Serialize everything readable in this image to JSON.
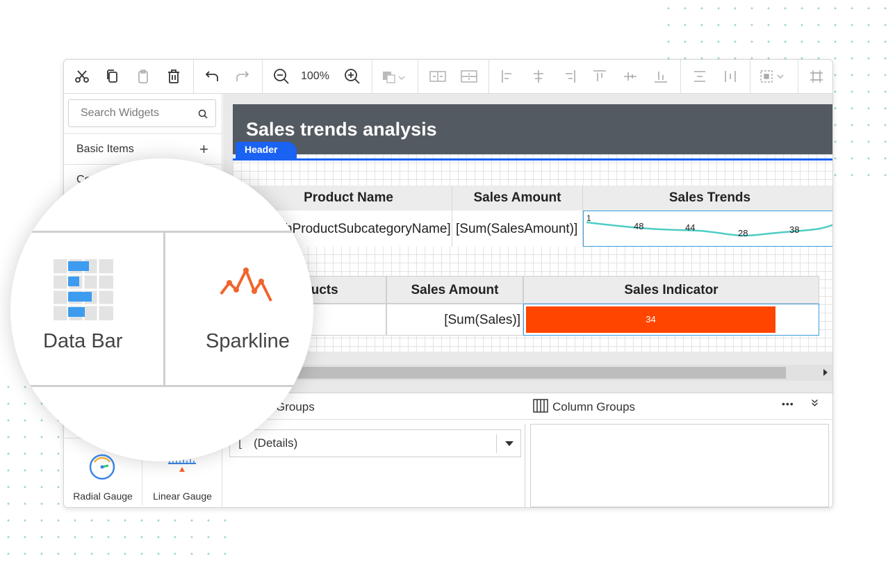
{
  "toolbar": {
    "zoom_level": "100%",
    "icons": [
      "cut-icon",
      "copy-icon",
      "paste-icon",
      "delete-icon",
      "undo-icon",
      "redo-icon",
      "zoom-out-icon",
      "zoom-in-icon",
      "fill-color-icon",
      "align-icons",
      "layout-icons"
    ]
  },
  "sidebar": {
    "search_placeholder": "Search Widgets",
    "categories": [
      {
        "label": "Basic Items",
        "expand": "+"
      },
      {
        "label": "Co"
      }
    ],
    "widgets": [
      {
        "label": "Radial Gauge",
        "icon": "radial-gauge-icon"
      },
      {
        "label": "Linear Gauge",
        "icon": "linear-gauge-icon"
      }
    ]
  },
  "magnifier": {
    "widgets": [
      {
        "label": "Data Bar",
        "icon": "data-bar-icon"
      },
      {
        "label": "Sparkline",
        "icon": "sparkline-icon"
      }
    ],
    "accent_color": "#4aa3f0",
    "sparkline_color": "#f0652d"
  },
  "report": {
    "title": "Sales trends analysis",
    "header_tag": "Header",
    "table1": {
      "headers": [
        "Product Name",
        "Sales Amount",
        "Sales Trends"
      ],
      "row": [
        "[EnglishProductSubcategoryName]",
        "[Sum(SalesAmount)]"
      ]
    },
    "sparkline": {
      "labels": [
        "1",
        "48",
        "44",
        "28",
        "38"
      ],
      "line_color": "#4ecdc4"
    },
    "table2": {
      "headers": [
        "Products",
        "Sales Amount",
        "Sales Indicator"
      ],
      "row": [
        "",
        "[Sum(Sales)]"
      ],
      "databar": {
        "value": "34",
        "fill": 0.86,
        "color": "#ff4500"
      }
    }
  },
  "groups": {
    "row_groups_label": "Groups",
    "column_groups_label": "Column Groups",
    "details_value": "(Details)",
    "more": "•••",
    "collapse": "»"
  }
}
